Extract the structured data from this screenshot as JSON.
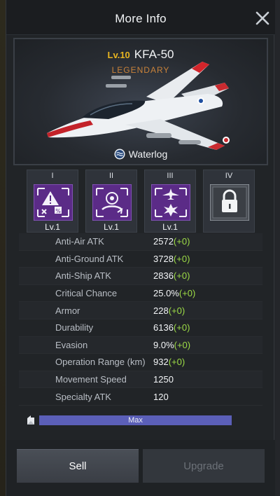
{
  "dialog": {
    "title": "More Info"
  },
  "unit": {
    "level_label": "Lv.10",
    "name": "KFA-50",
    "rarity": "LEGENDARY",
    "skin": "Waterlog"
  },
  "skills": [
    {
      "numeral": "I",
      "level": "Lv.1",
      "icon": "target-warning-icon",
      "locked": false
    },
    {
      "numeral": "II",
      "level": "Lv.1",
      "icon": "radar-lock-icon",
      "locked": false
    },
    {
      "numeral": "III",
      "level": "Lv.1",
      "icon": "aircraft-strike-icon",
      "locked": false
    },
    {
      "numeral": "IV",
      "level": "",
      "icon": "lock-icon",
      "locked": true
    }
  ],
  "stats": [
    {
      "label": "Anti-Air ATK",
      "value": "2572",
      "bonus": "(+0)"
    },
    {
      "label": "Anti-Ground ATK",
      "value": "3728",
      "bonus": "(+0)"
    },
    {
      "label": "Anti-Ship ATK",
      "value": "2836",
      "bonus": "(+0)"
    },
    {
      "label": "Critical Chance",
      "value": "25.0%",
      "bonus": "(+0)"
    },
    {
      "label": "Armor",
      "value": "228",
      "bonus": "(+0)"
    },
    {
      "label": "Durability",
      "value": "6136",
      "bonus": "(+0)"
    },
    {
      "label": "Evasion",
      "value": "9.0%",
      "bonus": "(+0)"
    },
    {
      "label": "Operation Range (km)",
      "value": "932",
      "bonus": "(+0)"
    },
    {
      "label": "Movement Speed",
      "value": "1250",
      "bonus": ""
    },
    {
      "label": "Specialty ATK",
      "value": "120",
      "bonus": ""
    }
  ],
  "progress": {
    "label": "Max",
    "fraction": 1.0
  },
  "actions": {
    "sell_label": "Sell",
    "upgrade_label": "Upgrade"
  },
  "colors": {
    "level_gold": "#e8b520",
    "rarity_orange": "#c8823a",
    "bonus_green": "#9ddc46",
    "skill_purple": "#5a2a86",
    "progress_fill": "#5b5fb8"
  }
}
